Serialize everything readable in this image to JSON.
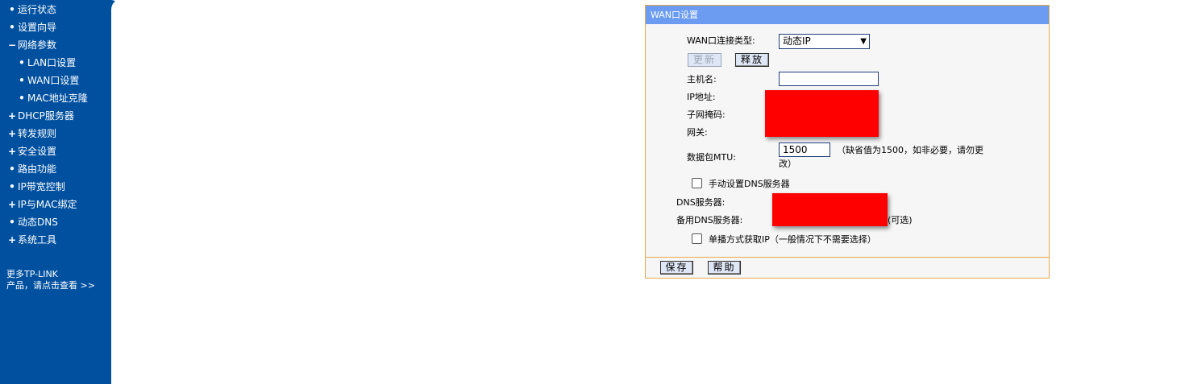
{
  "sidebar": {
    "items": [
      {
        "bullet": "•",
        "label": "运行状态"
      },
      {
        "bullet": "•",
        "label": "设置向导"
      },
      {
        "bullet": "−",
        "label": "网络参数"
      },
      {
        "bullet": "•",
        "label": "LAN口设置"
      },
      {
        "bullet": "•",
        "label": "WAN口设置"
      },
      {
        "bullet": "•",
        "label": "MAC地址克隆"
      },
      {
        "bullet": "+",
        "label": "DHCP服务器"
      },
      {
        "bullet": "+",
        "label": "转发规则"
      },
      {
        "bullet": "+",
        "label": "安全设置"
      },
      {
        "bullet": "•",
        "label": "路由功能"
      },
      {
        "bullet": "•",
        "label": "IP带宽控制"
      },
      {
        "bullet": "+",
        "label": "IP与MAC绑定"
      },
      {
        "bullet": "•",
        "label": "动态DNS"
      },
      {
        "bullet": "+",
        "label": "系统工具"
      }
    ],
    "more_line1": "更多TP-LINK",
    "more_line2": "产品，请点击查看 >>"
  },
  "panel": {
    "title": "WAN口设置",
    "conn_type_label": "WAN口连接类型:",
    "conn_type_value": "动态IP",
    "renew_label": "更新",
    "release_label": "释放",
    "hostname_label": "主机名:",
    "hostname_value": "",
    "ip_label": "IP地址:",
    "mask_label": "子网掩码:",
    "gateway_label": "网关:",
    "mtu_label": "数据包MTU:",
    "mtu_value": "1500",
    "mtu_hint_1": "（缺省值为1500，如非必要，请勿更",
    "mtu_hint_2": "改）",
    "manual_dns_label": "手动设置DNS服务器",
    "dns_label": "DNS服务器:",
    "backup_dns_label": "备用DNS服务器:",
    "optional_label": "(可选)",
    "unicast_label": "单播方式获取IP（一般情况下不需要选择）",
    "save_label": "保存",
    "help_label": "帮助"
  },
  "colors": {
    "sidebar_bg": "#0050a0",
    "panel_header": "#6b9cf2",
    "panel_border": "#e8a94a",
    "redaction": "#ff0000"
  }
}
